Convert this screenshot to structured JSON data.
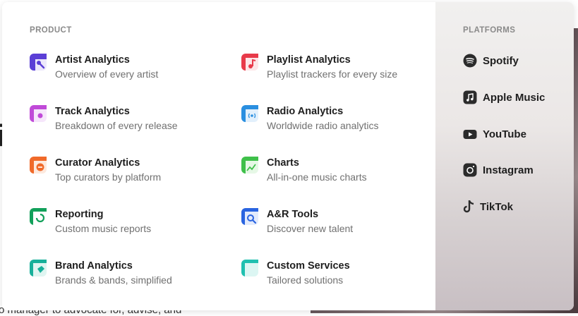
{
  "background": {
    "text_fragment": "o manager to advocate for, advise, and",
    "glyph": "i"
  },
  "menu": {
    "product": {
      "heading": "PRODUCT",
      "items": [
        {
          "title": "Artist Analytics",
          "subtitle": "Overview of every artist",
          "icon": "artist-analytics-icon",
          "color": "#5b3fd6"
        },
        {
          "title": "Playlist Analytics",
          "subtitle": "Playlist trackers for every size",
          "icon": "playlist-analytics-icon",
          "color": "#e83a4a"
        },
        {
          "title": "Track Analytics",
          "subtitle": "Breakdown of every release",
          "icon": "track-analytics-icon",
          "color": "#c04ad8"
        },
        {
          "title": "Radio Analytics",
          "subtitle": "Worldwide radio analytics",
          "icon": "radio-analytics-icon",
          "color": "#2a8fe0"
        },
        {
          "title": "Curator Analytics",
          "subtitle": "Top curators by platform",
          "icon": "curator-analytics-icon",
          "color": "#f06a2a"
        },
        {
          "title": "Charts",
          "subtitle": "All-in-one music charts",
          "icon": "charts-icon",
          "color": "#3fc04a"
        },
        {
          "title": "Reporting",
          "subtitle": "Custom music reports",
          "icon": "reporting-icon",
          "color": "#12a05a"
        },
        {
          "title": "A&R Tools",
          "subtitle": "Discover new talent",
          "icon": "ar-tools-icon",
          "color": "#2a64e0"
        },
        {
          "title": "Brand Analytics",
          "subtitle": "Brands & bands, simplified",
          "icon": "brand-analytics-icon",
          "color": "#18b09a"
        },
        {
          "title": "Custom Services",
          "subtitle": "Tailored solutions",
          "icon": "custom-services-icon",
          "color": "#20c0b0"
        }
      ]
    },
    "platforms": {
      "heading": "PLATFORMS",
      "items": [
        {
          "label": "Spotify",
          "icon": "spotify-icon"
        },
        {
          "label": "Apple Music",
          "icon": "apple-music-icon"
        },
        {
          "label": "YouTube",
          "icon": "youtube-icon"
        },
        {
          "label": "Instagram",
          "icon": "instagram-icon"
        },
        {
          "label": "TikTok",
          "icon": "tiktok-icon"
        }
      ]
    }
  }
}
